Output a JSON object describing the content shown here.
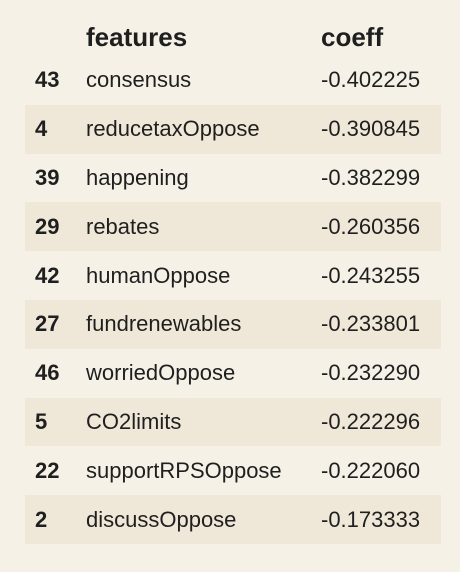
{
  "table": {
    "columns": [
      "features",
      "coeff"
    ],
    "rows": [
      {
        "index": "43",
        "feature": "consensus",
        "coeff": "-0.402225"
      },
      {
        "index": "4",
        "feature": "reducetaxOppose",
        "coeff": "-0.390845"
      },
      {
        "index": "39",
        "feature": "happening",
        "coeff": "-0.382299"
      },
      {
        "index": "29",
        "feature": "rebates",
        "coeff": "-0.260356"
      },
      {
        "index": "42",
        "feature": "humanOppose",
        "coeff": "-0.243255"
      },
      {
        "index": "27",
        "feature": "fundrenewables",
        "coeff": "-0.233801"
      },
      {
        "index": "46",
        "feature": "worriedOppose",
        "coeff": "-0.232290"
      },
      {
        "index": "5",
        "feature": "CO2limits",
        "coeff": "-0.222296"
      },
      {
        "index": "22",
        "feature": "supportRPSOppose",
        "coeff": "-0.222060"
      },
      {
        "index": "2",
        "feature": "discussOppose",
        "coeff": "-0.173333"
      }
    ]
  },
  "colors": {
    "background": "#f6f1e7",
    "stripe": "#efe8d8",
    "text": "#1f1f1f"
  }
}
